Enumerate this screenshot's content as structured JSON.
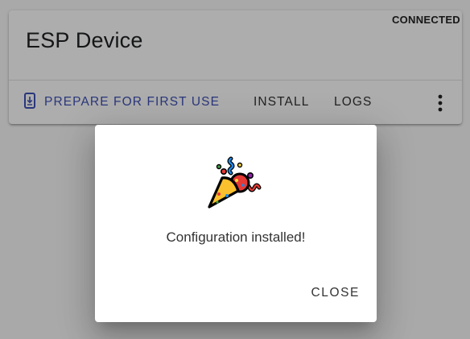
{
  "device": {
    "title": "ESP Device",
    "status": "CONNECTED",
    "actions": {
      "prepare_label": "PREPARE FOR FIRST USE",
      "install_label": "INSTALL",
      "logs_label": "LOGS"
    }
  },
  "dialog": {
    "message": "Configuration installed!",
    "close_label": "CLOSE"
  },
  "colors": {
    "accent": "#3f51b5",
    "scrim": "rgba(0,0,0,0.32)"
  },
  "icons": {
    "prepare": "install-to-device-icon",
    "more": "more-vertical-icon",
    "success": "party-popper-icon"
  }
}
